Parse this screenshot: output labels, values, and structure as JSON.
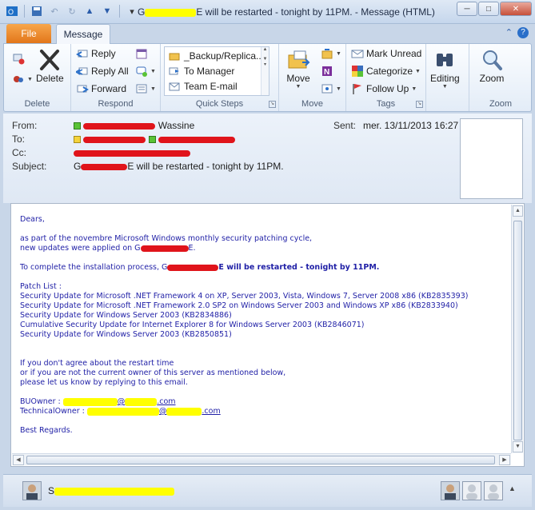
{
  "window": {
    "title_prefix": "G",
    "title_suffix": "E will be restarted - tonight by 11PM.  -  Message (HTML)",
    "minimize": "─",
    "maximize": "□",
    "close": "✕"
  },
  "tabs": {
    "file": "File",
    "message": "Message",
    "help": "?",
    "collapse": "⌃"
  },
  "ribbon": {
    "delete_group": {
      "label": "Delete",
      "delete_button": "Delete"
    },
    "respond_group": {
      "label": "Respond",
      "reply": "Reply",
      "reply_all": "Reply All",
      "forward": "Forward"
    },
    "quick_steps_group": {
      "label": "Quick Steps",
      "items": [
        "_Backup/Replica...",
        "To Manager",
        "Team E-mail"
      ]
    },
    "move_group": {
      "label": "Move",
      "move_button": "Move"
    },
    "tags_group": {
      "label": "Tags",
      "mark_unread": "Mark Unread",
      "categorize": "Categorize",
      "follow_up": "Follow Up"
    },
    "editing_group": {
      "editing_button": "Editing"
    },
    "zoom_group": {
      "label": "Zoom",
      "zoom_button": "Zoom"
    }
  },
  "header": {
    "from_label": "From:",
    "from_value": "Wassine",
    "to_label": "To:",
    "cc_label": "Cc:",
    "subject_label": "Subject:",
    "subject_prefix": "G",
    "subject_suffix": "E will be restarted - tonight by 11PM.",
    "sent_label": "Sent:",
    "sent_value": "mer. 13/11/2013 16:27"
  },
  "body": {
    "greeting": "Dears,",
    "line1": "as part of the novembre Microsoft Windows monthly security patching cycle,",
    "line2_prefix": "new updates were applied on G",
    "line2_suffix": "E.",
    "line3_prefix": "To complete the installation process, G",
    "line3_suffix": "E will be restarted - tonight by 11PM.",
    "patch_heading": "Patch List :",
    "patches": [
      "Security Update for Microsoft .NET Framework 4 on XP, Server 2003, Vista, Windows 7, Server 2008 x86 (KB2835393)",
      "Security Update for Microsoft .NET Framework 2.0 SP2 on Windows Server 2003 and Windows XP x86 (KB2833940)",
      "Security Update for Windows Server 2003 (KB2834886)",
      "Cumulative Security Update for Internet Explorer 8 for Windows Server 2003 (KB2846071)",
      "Security Update for Windows Server 2003 (KB2850851)"
    ],
    "para1": "If you don't agree about the restart time",
    "para2": "or if you are not the current owner of this server as mentioned below,",
    "para3": "please let us know by replying to this email.",
    "bu_owner_label": "BUOwner : ",
    "bu_owner_email_tail": "@",
    "bu_owner_email_end": ".com",
    "tech_owner_label": "TechnicalOwner : ",
    "tech_owner_email_tail": "@",
    "tech_owner_email_end": ".com",
    "closing": "Best Regards."
  },
  "people_bar": {
    "name_prefix": "S"
  },
  "colors": {
    "file_tab": "#e2761a",
    "body_text": "#1f1fa6",
    "redaction_red": "#e0141b",
    "redaction_yellow": "#ffff00"
  }
}
